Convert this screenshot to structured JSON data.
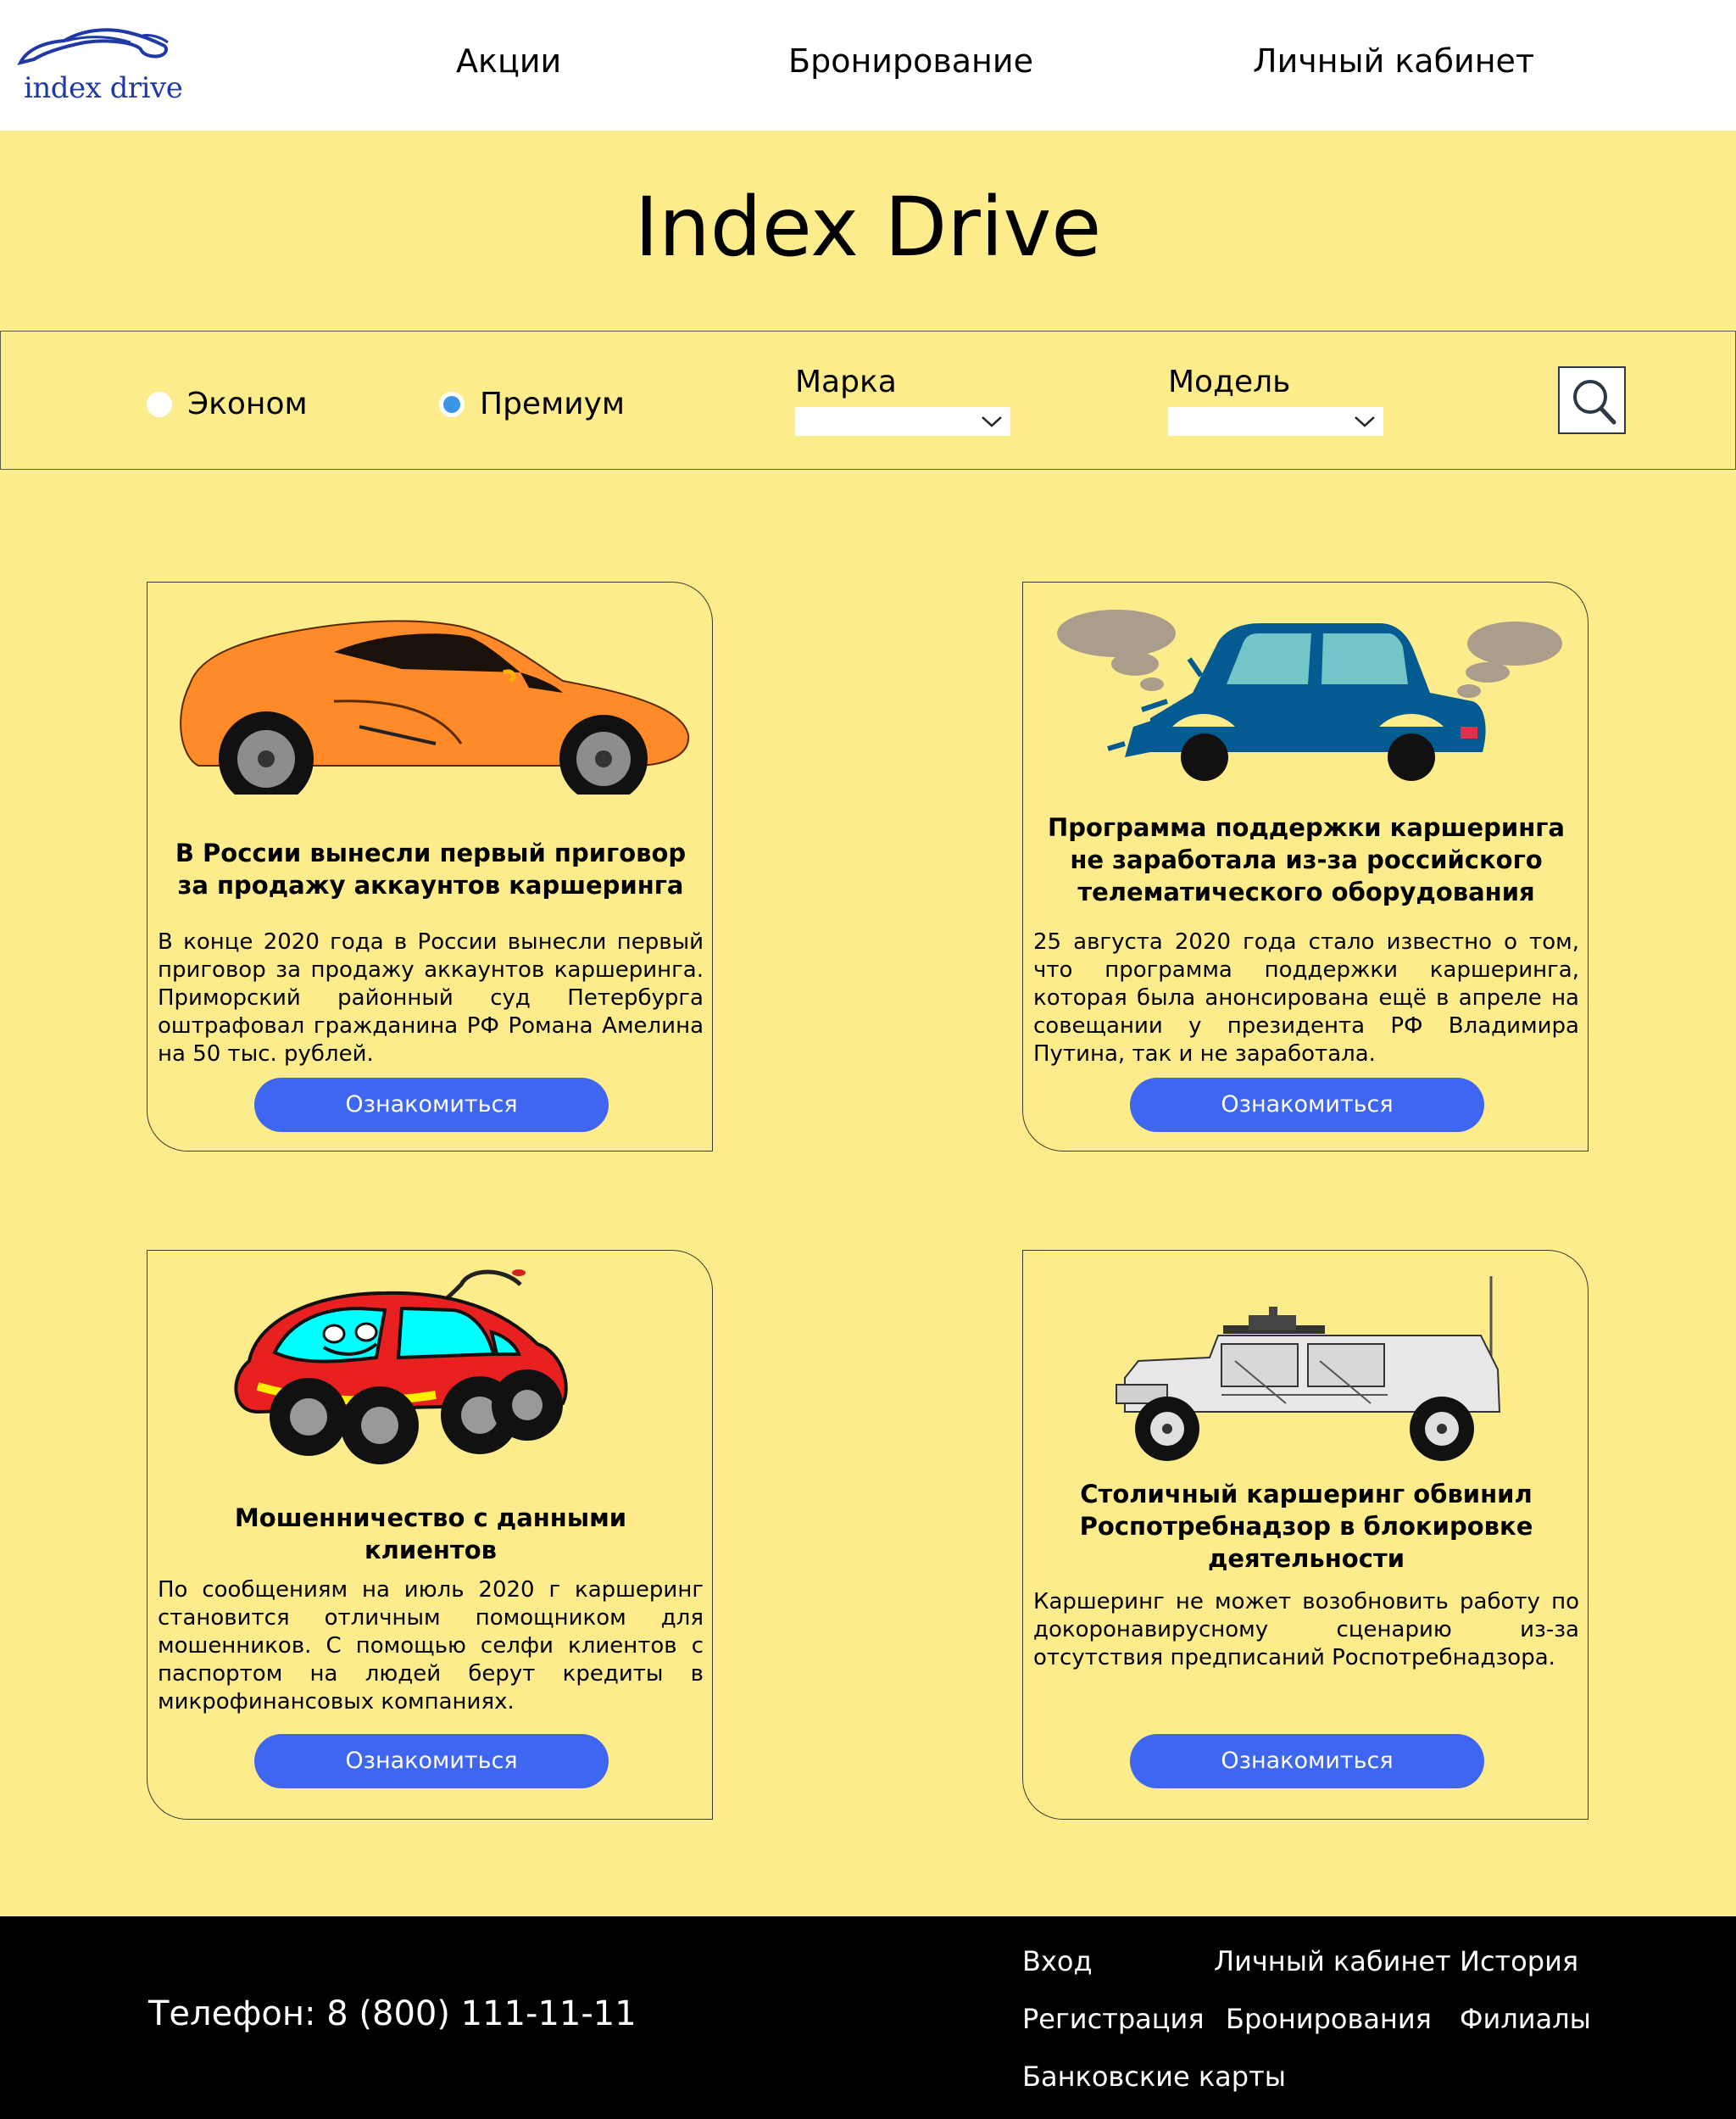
{
  "header": {
    "logo_text": "index drive",
    "nav": [
      "Акции",
      "Бронирование",
      "Личный кабинет"
    ]
  },
  "hero": {
    "title": "Index Drive"
  },
  "filter": {
    "radios": [
      {
        "label": "Эконом",
        "checked": false
      },
      {
        "label": "Премиум",
        "checked": true
      }
    ],
    "brand_label": "Марка",
    "brand_value": "",
    "model_label": "Модель",
    "model_value": "",
    "search_icon": "search-icon"
  },
  "cards": [
    {
      "image": "orange-sports-car",
      "title": "В России вынесли первый приговор за продажу аккаунтов каршеринга",
      "text": "В конце 2020 года в России вынесли первый приговор за продажу аккаунтов каршеринга. Приморский районный суд Петербурга оштрафовал гражданина РФ Романа Амелина на 50 тыс. рублей.",
      "button": "Ознакомиться"
    },
    {
      "image": "crashed-blue-car",
      "title": "Программа поддержки каршеринга не заработала из-за российского телематического оборудования",
      "text": "25 августа 2020 года стало известно о том, что программа поддержки каршеринга, которая была анонсирована ещё в апреле на совещании у президента РФ Владимира Путина, так и не заработала.",
      "button": "Ознакомиться"
    },
    {
      "image": "cartoon-red-car",
      "title": "Мошенничество с данными клиентов",
      "text": "По сообщениям на июль 2020 г каршеринг становится отличным помощником для мошенников. С помощью селфи клиентов с паспортом на людей берут кредиты в микрофинансовых компаниях.",
      "button": "Ознакомиться"
    },
    {
      "image": "military-humvee",
      "title": "Столичный каршеринг обвинил Роспотребнадзор в блокировке деятельности",
      "text": "Каршеринг не может возобновить работу по докоронавирусному сценарию из-за отсутствия предписаний Роспотребнадзора.",
      "button": "Ознакомиться"
    }
  ],
  "footer": {
    "phone": "Телефон: 8 (800) 111-11-11",
    "links": [
      "Вход",
      "Личный кабинет",
      "История",
      "Регистрация",
      "Бронирования",
      "Филиалы",
      "Банковские карты"
    ]
  },
  "colors": {
    "background": "#fdec8c",
    "button": "#3e66f0",
    "footer": "#000000",
    "radio_checked": "#3d95e8"
  }
}
